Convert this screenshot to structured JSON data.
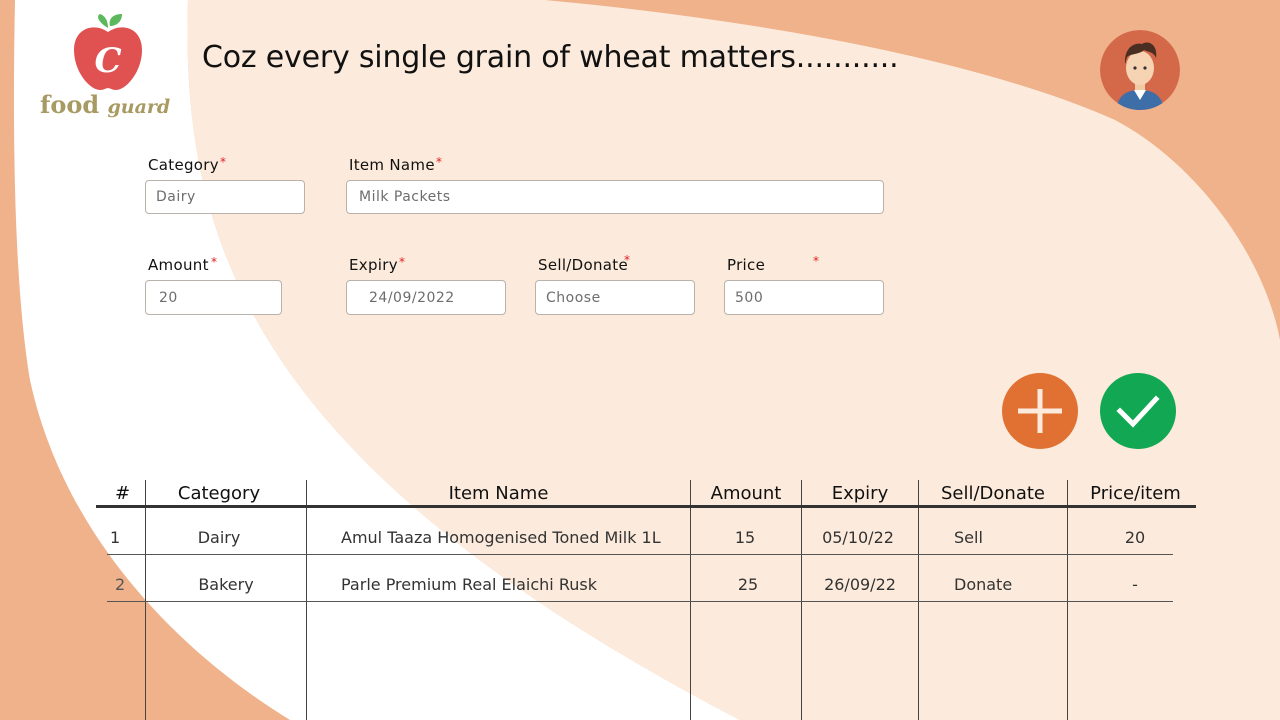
{
  "brand": {
    "logo_letter": "C",
    "name_part1": "food",
    "name_part2": "guard"
  },
  "tagline": "Coz every single grain of wheat matters...........",
  "form": {
    "category": {
      "label": "Category",
      "value": "Dairy"
    },
    "item_name": {
      "label": "Item Name",
      "value": "Milk Packets"
    },
    "amount": {
      "label": "Amount",
      "value": "20"
    },
    "expiry": {
      "label": "Expiry",
      "value": "24/09/2022"
    },
    "sell_donate": {
      "label": "Sell/Donate",
      "placeholder": "Choose"
    },
    "price": {
      "label": "Price",
      "value": "500"
    },
    "required_mark": "*"
  },
  "actions": {
    "add_icon": "plus-icon",
    "confirm_icon": "check-icon",
    "add_color": "#e07133",
    "confirm_color": "#12a853"
  },
  "table": {
    "headers": [
      "#",
      "Category",
      "Item Name",
      "Amount",
      "Expiry",
      "Sell/Donate",
      "Price/item"
    ],
    "rows": [
      [
        "1",
        "Dairy",
        "Amul Taaza Homogenised Toned Milk 1L",
        "15",
        "05/10/22",
        "Sell",
        "20"
      ],
      [
        "2",
        "Bakery",
        "Parle Premium Real Elaichi Rusk",
        "25",
        "26/09/22",
        "Donate",
        "-"
      ]
    ]
  },
  "colors": {
    "background_orange": "#efb28b",
    "cream": "#fcebdc",
    "white": "#ffffff"
  }
}
